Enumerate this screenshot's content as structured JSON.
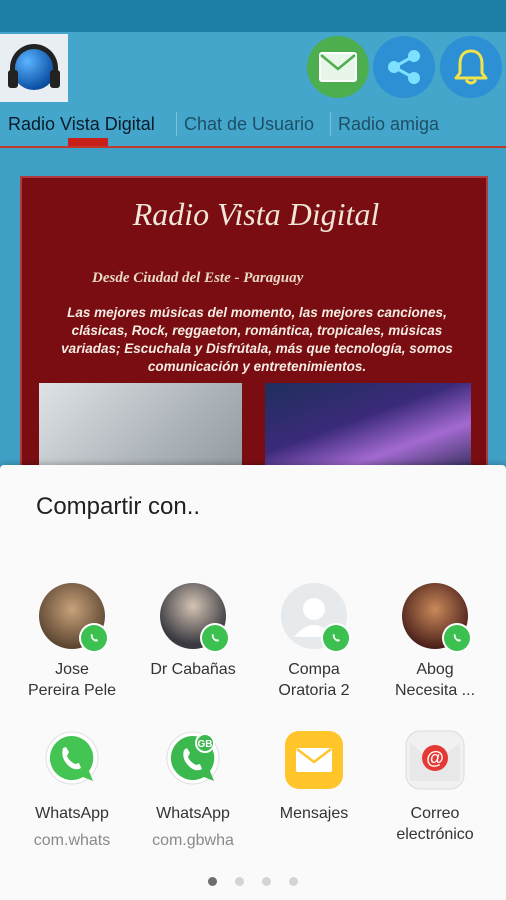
{
  "app": {
    "title": "Radio Vista Digital"
  },
  "header": {
    "icons": [
      "radio-logo",
      "mail-icon",
      "share-icon",
      "bell-icon"
    ],
    "colors": {
      "mail": "#4cae4f",
      "action": "#2d8fd4",
      "bar": "#45a6cc",
      "accent": "#c8201a"
    }
  },
  "tabs": [
    {
      "label": "Radio Vista Digital",
      "active": true
    },
    {
      "label": "Chat de Usuario",
      "active": false
    },
    {
      "label": "Radio amiga",
      "active": false
    }
  ],
  "banner": {
    "title": "Radio Vista Digital",
    "subtitle": "Desde Ciudad del Este - Paraguay",
    "text": "Las mejores músicas del momento, las mejores canciones, clásicas, Rock, reggaeton, romántica, tropicales, músicas variadas; Escuchala y Disfrútala, más que tecnología, somos comunicación  y entretenimientos."
  },
  "share_sheet": {
    "title": "Compartir con..",
    "contacts": [
      {
        "name_line1": "Jose",
        "name_line2": "Pereira Pele",
        "badge": "whatsapp-icon"
      },
      {
        "name_line1": "Dr Cabañas",
        "name_line2": "",
        "badge": "whatsapp-gb-icon"
      },
      {
        "name_line1": "Compa",
        "name_line2": "Oratoria 2",
        "badge": "whatsapp-gb-icon"
      },
      {
        "name_line1": "Abog",
        "name_line2": "Necesita ...",
        "badge": "whatsapp-gb-icon"
      }
    ],
    "apps": [
      {
        "label": "WhatsApp",
        "sub": "com.whats",
        "icon": "whatsapp-icon"
      },
      {
        "label": "WhatsApp",
        "sub": "com.gbwha",
        "icon": "whatsapp-gb-icon"
      },
      {
        "label": "Mensajes",
        "sub": "",
        "icon": "messages-icon"
      },
      {
        "label_line1": "Correo",
        "label_line2": "electrónico",
        "icon": "email-icon"
      }
    ],
    "pages": 4,
    "current_page": 1
  }
}
